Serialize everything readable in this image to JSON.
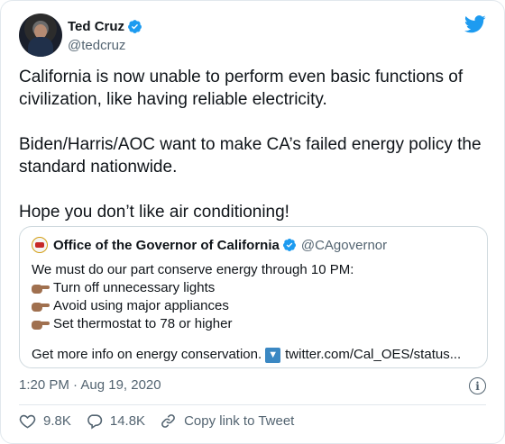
{
  "author": {
    "name": "Ted Cruz",
    "handle": "@tedcruz"
  },
  "tweet": {
    "paragraphs": [
      "California is now unable to perform even basic functions of civilization, like having reliable electricity.",
      "Biden/Harris/AOC want to make CA’s failed energy policy the standard nationwide.",
      "Hope you don’t like air conditioning!"
    ]
  },
  "quote": {
    "name": "Office of the Governor of California",
    "handle": "@CAgovernor",
    "intro": "We must do our part conserve energy through 10 PM:",
    "bullets": [
      "Turn off unnecessary lights",
      "Avoid using major appliances",
      "Set thermostat to 78 or higher"
    ],
    "more_text": "Get more info on energy conservation.",
    "link": "twitter.com/Cal_OES/status..."
  },
  "meta": {
    "timestamp": "1:20 PM · Aug 19, 2020"
  },
  "actions": {
    "likes": "9.8K",
    "replies": "14.8K",
    "copy_link": "Copy link to Tweet"
  },
  "colors": {
    "verified": "#1d9bf0",
    "twitter_blue": "#1d9bf0",
    "secondary_text": "#536471"
  }
}
